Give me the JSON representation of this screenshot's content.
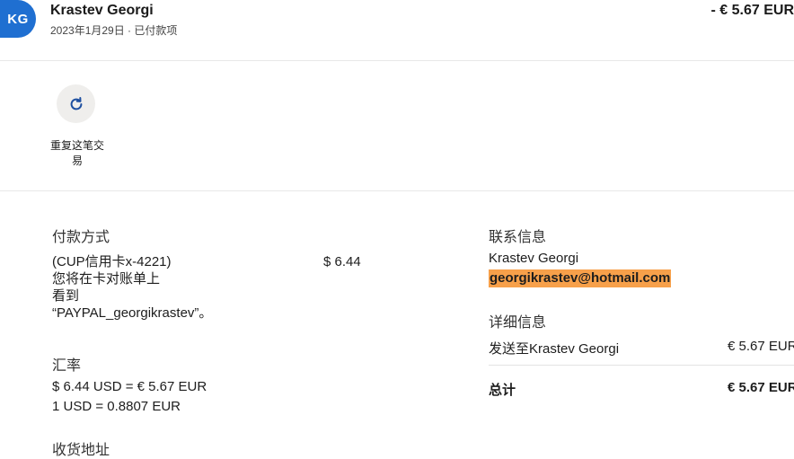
{
  "header": {
    "avatar_initials": "KG",
    "name": "Krastev Georgi",
    "date_status": "2023年1月29日 · 已付款项",
    "amount": "- € 5.67 EUR"
  },
  "actions": {
    "repeat_label": "重复这笔交易",
    "repeat_icon": "refresh-icon"
  },
  "payment": {
    "title": "付款方式",
    "method": "(CUP信用卡x-4221)",
    "amount": "$ 6.44",
    "note_lines": [
      "您将在卡对账单上",
      "看到",
      "“PAYPAL_georgikrastev”。"
    ]
  },
  "exchange": {
    "title": "汇率",
    "line1": "$ 6.44 USD = € 5.67 EUR",
    "line2": "1 USD = 0.8807 EUR"
  },
  "shipping": {
    "title": "收货地址"
  },
  "contact": {
    "title": "联系信息",
    "name": "Krastev Georgi",
    "email": "georgikrastev@hotmail.com"
  },
  "details": {
    "title": "详细信息",
    "sent_to_label": "发送至Krastev Georgi",
    "sent_to_amount": "€ 5.67 EUR",
    "total_label": "总计",
    "total_amount": "€ 5.67 EUR"
  },
  "colors": {
    "avatar": "#1f6fd1",
    "highlight": "#f7a04a",
    "icon": "#1d4fa0"
  }
}
